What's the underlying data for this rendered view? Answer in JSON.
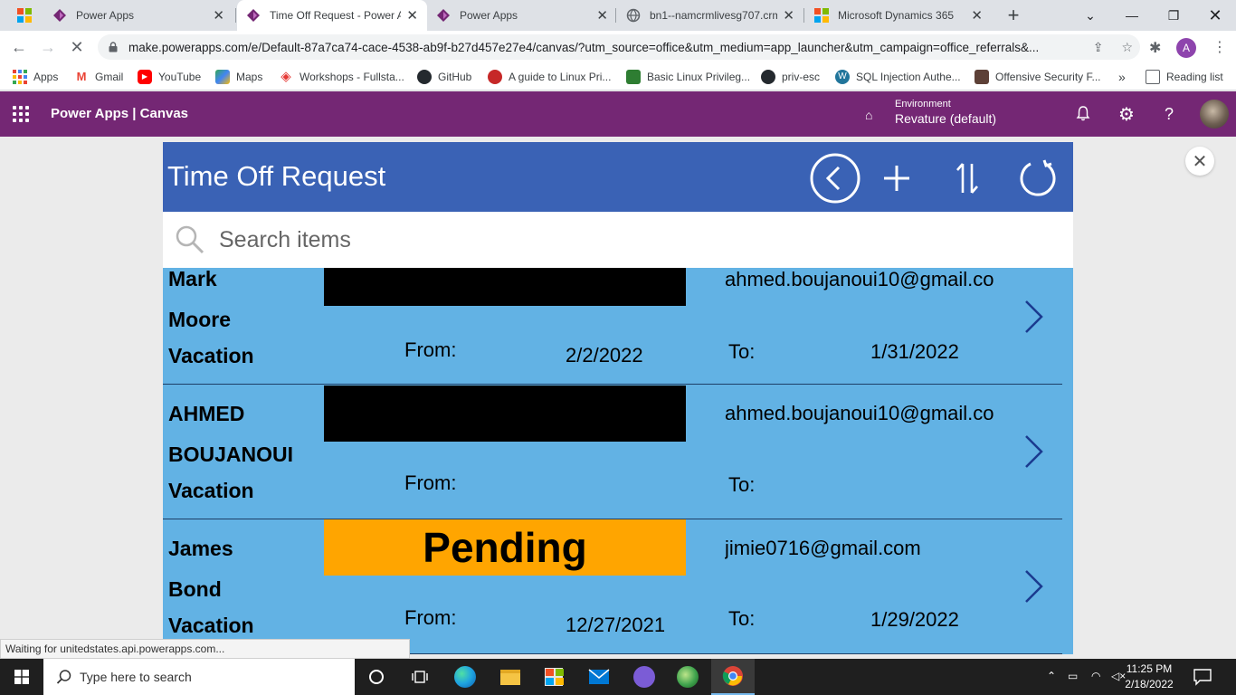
{
  "browser": {
    "tabs": [
      {
        "title": "Power Apps",
        "icon": "powerapps-icon"
      },
      {
        "title": "Time Off Request - Power A",
        "icon": "powerapps-icon"
      },
      {
        "title": "Power Apps",
        "icon": "powerapps-icon"
      },
      {
        "title": "bn1--namcrmlivesg707.crm",
        "icon": "globe-icon"
      },
      {
        "title": "Microsoft Dynamics 365",
        "icon": "microsoft-icon"
      }
    ],
    "new_tab_label": "+",
    "url": "make.powerapps.com/e/Default-87a7ca74-cace-4538-ab9f-b27d457e27e4/canvas/?utm_source=office&utm_medium=app_launcher&utm_campaign=office_referrals&...",
    "avatar_letter": "A",
    "bookmarks": [
      {
        "label": "Apps",
        "color": "#4285f4"
      },
      {
        "label": "Gmail",
        "color": "#ea4335"
      },
      {
        "label": "YouTube",
        "color": "#ff0000"
      },
      {
        "label": "Maps",
        "color": "#34a853"
      },
      {
        "label": "Workshops - Fullsta...",
        "color": "#e53935"
      },
      {
        "label": "GitHub",
        "color": "#24292e"
      },
      {
        "label": "A guide to Linux Pri...",
        "color": "#c62828"
      },
      {
        "label": "Basic Linux Privileg...",
        "color": "#2e7d32"
      },
      {
        "label": "priv-esc",
        "color": "#24292e"
      },
      {
        "label": "SQL Injection Authe...",
        "color": "#21759b"
      },
      {
        "label": "Offensive Security F...",
        "color": "#5d4037"
      }
    ],
    "bookmarks_more": "»",
    "reading_list": "Reading list"
  },
  "powerapps_header": {
    "title": "Power Apps  |  Canvas",
    "environment_label": "Environment",
    "environment_value": "Revature (default)",
    "brand_color": "#742774"
  },
  "app": {
    "title": "Time Off Request",
    "search_placeholder": "Search items",
    "header_color": "#3a62b5",
    "gallery_color": "#62b2e4",
    "items": [
      {
        "first_name": "Mark",
        "last_name": "Moore",
        "request_type": "Vacation",
        "status": "",
        "email": "ahmed.boujanoui10@gmail.co",
        "from_label": "From:",
        "from_date": "2/2/2022",
        "to_label": "To:",
        "to_date": "1/31/2022",
        "status_color": "#000000"
      },
      {
        "first_name": "AHMED",
        "last_name": "BOUJANOUI",
        "request_type": "Vacation",
        "status": "",
        "email": "ahmed.boujanoui10@gmail.co",
        "from_label": "From:",
        "from_date": "",
        "to_label": "To:",
        "to_date": "",
        "status_color": "#000000"
      },
      {
        "first_name": "James",
        "last_name": "Bond",
        "request_type": "Vacation",
        "status": "Pending",
        "email": "jimie0716@gmail.com",
        "from_label": "From:",
        "from_date": "12/27/2021",
        "to_label": "To:",
        "to_date": "1/29/2022",
        "status_color": "#ffa500"
      }
    ]
  },
  "statusbar": {
    "text": "Waiting for unitedstates.api.powerapps.com..."
  },
  "taskbar": {
    "search_placeholder": "Type here to search",
    "time": "11:25 PM",
    "date": "2/18/2022"
  }
}
